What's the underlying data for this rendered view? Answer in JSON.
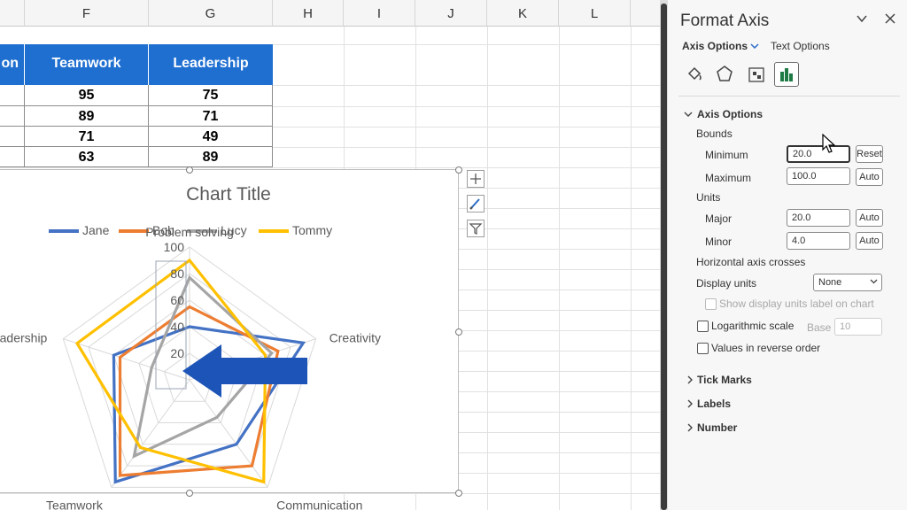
{
  "sheet": {
    "columns": [
      "F",
      "G",
      "H",
      "I",
      "J",
      "K",
      "L"
    ],
    "header_row": [
      "on",
      "Teamwork",
      "Leadership"
    ],
    "rows": [
      [
        "95",
        "75"
      ],
      [
        "89",
        "71"
      ],
      [
        "71",
        "49"
      ],
      [
        "63",
        "89"
      ]
    ]
  },
  "chart": {
    "title": "Chart Title",
    "accent_arrow_color": "#1d54b8",
    "chart_data": {
      "type": "radar",
      "categories": [
        "Problem solving",
        "Creativity",
        "Communication",
        "Teamwork",
        "Leadership"
      ],
      "axis_labels": [
        "100",
        "80",
        "60",
        "40",
        "20"
      ],
      "ylim": [
        0,
        100
      ],
      "series": [
        {
          "name": "Jane",
          "color": "#4472c4",
          "values": [
            40,
            90,
            60,
            95,
            60
          ]
        },
        {
          "name": "Bob",
          "color": "#ed7d31",
          "values": [
            55,
            70,
            80,
            89,
            55
          ]
        },
        {
          "name": "Lucy",
          "color": "#a5a5a5",
          "values": [
            77,
            65,
            35,
            71,
            30
          ]
        },
        {
          "name": "Tommy",
          "color": "#ffc000",
          "values": [
            90,
            60,
            95,
            63,
            89
          ]
        }
      ]
    },
    "buttons": [
      "chart-elements",
      "chart-styles",
      "chart-filters"
    ]
  },
  "pane": {
    "title": "Format Axis",
    "tabs": {
      "axis_options": "Axis Options",
      "text_options": "Text Options"
    },
    "section_axis_options": "Axis Options",
    "bounds": "Bounds",
    "minimum": {
      "label": "Minimum",
      "value": "20.0",
      "button": "Reset"
    },
    "maximum": {
      "label": "Maximum",
      "value": "100.0",
      "button": "Auto"
    },
    "units": "Units",
    "major": {
      "label": "Major",
      "value": "20.0",
      "button": "Auto"
    },
    "minor": {
      "label": "Minor",
      "value": "4.0",
      "button": "Auto"
    },
    "horizontal_axis_crosses": "Horizontal axis crosses",
    "display_units": {
      "label": "Display units",
      "value": "None"
    },
    "show_display_units": "Show display units label on chart",
    "log_scale": {
      "label": "Logarithmic scale",
      "base_label": "Base",
      "base_value": "10"
    },
    "reverse_order": "Values in reverse order",
    "tick_marks": "Tick Marks",
    "labels": "Labels",
    "number": "Number"
  }
}
